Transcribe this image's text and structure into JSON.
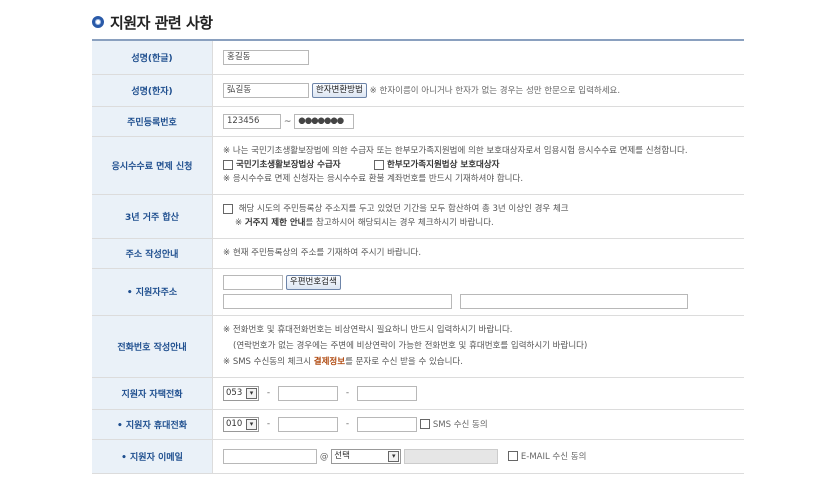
{
  "section_title": "지원자 관련 사항",
  "rows": {
    "name_kr": {
      "label": "성명(한글)",
      "value": "홍길동"
    },
    "name_hanja": {
      "label": "성명(한자)",
      "value": "弘길동",
      "button": "한자변환방법",
      "note": "※ 한자이름이 아니거나 한자가 없는 경우는 성만 한문으로 입력하세요."
    },
    "rrn": {
      "label": "주민등록번호",
      "front": "123456",
      "sep": "~",
      "back": "●●●●●●●"
    },
    "fee": {
      "label": "응시수수료 면제 신청",
      "note1": "※ 나는 국민기초생활보장법에 의한 수급자 또는 한부모가족지원법에 의한 보호대상자로서 임용시험 응시수수료 면제를 신청합니다.",
      "opt1": "국민기초생활보장법상 수급자",
      "opt2": "한부모가족지원법상 보호대상자",
      "note2": "※ 응시수수료 면제 신청자는 응시수수료 환불 계좌번호를 반드시 기재하셔야 합니다."
    },
    "residence": {
      "label": "3년 거주 합산",
      "check_text": "해당 시도의 주민등록상 주소지를 두고 있었던 기간을 모두 합산하여 총 3년 이상인 경우 체크",
      "note_prefix": "※ ",
      "note_bold": "거주지 제한 안내",
      "note_rest": "를 참고하시어 해당되시는 경우 체크하시기 바랍니다."
    },
    "address_guide": {
      "label": "주소 작성안내",
      "note": "※ 현재 주민등록상의 주소를 기재하여 주시기 바랍니다."
    },
    "address": {
      "label": "지원자주소",
      "button": "우편번호검색"
    },
    "phone_guide": {
      "label": "전화번호 작성안내",
      "note1": "※ 전화번호 및 휴대전화번호는 비상연락시 필요하니 반드시 입력하시기 바랍니다.",
      "note2": "(연락번호가 없는 경우에는 주변에 비상연락이 가능한 전화번호 및 휴대번호를 입력하시기 바랍니다)",
      "note3_pre": "※ SMS 수신동의 체크시 ",
      "note3_bold": "결제정보",
      "note3_post": "를 문자로 수신 받을 수 있습니다."
    },
    "home_phone": {
      "label": "지원자 자택전화",
      "area": "053"
    },
    "mobile": {
      "label": "지원자 휴대전화",
      "prefix": "010",
      "sms": "SMS 수신 동의"
    },
    "email": {
      "label": "지원자 이메일",
      "at": "@",
      "domain_select": "선택",
      "consent": "E-MAIL 수신 동의"
    }
  },
  "required_mark": "•"
}
